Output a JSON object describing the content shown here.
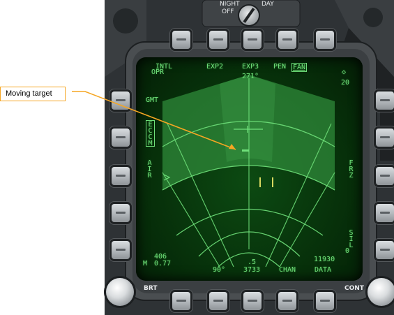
{
  "callout": {
    "label": "Moving target",
    "color": "#f5a623"
  },
  "knobs": {
    "night_day": {
      "night": "NIGHT",
      "day": "DAY",
      "off": "OFF"
    },
    "brt": "BRT",
    "cont": "CONT"
  },
  "radar": {
    "top_labels": [
      "INTL",
      "EXP2",
      "EXP3",
      "PEN",
      "FAN"
    ],
    "heading": "271°",
    "mode": "OPR",
    "range_symbol": "◇",
    "range": "20",
    "left_labels": {
      "gmt": "GMT",
      "eccm": "ECCM",
      "air": "AIR"
    },
    "right_labels": {
      "frz": "FRZ",
      "sil": "SIL",
      "sil_value": "0"
    },
    "bottom": {
      "mach_prefix": "M",
      "mach": "0.77",
      "airspeed": "406",
      "azimuth": "90°",
      "bar_count": ".5",
      "elevation": "3733",
      "chan": "CHAN",
      "altitude": "11930",
      "data": "DATA"
    },
    "colors": {
      "symbology": "#6fe07a",
      "scan": "#2f8a3a",
      "background": "#062c09"
    }
  }
}
